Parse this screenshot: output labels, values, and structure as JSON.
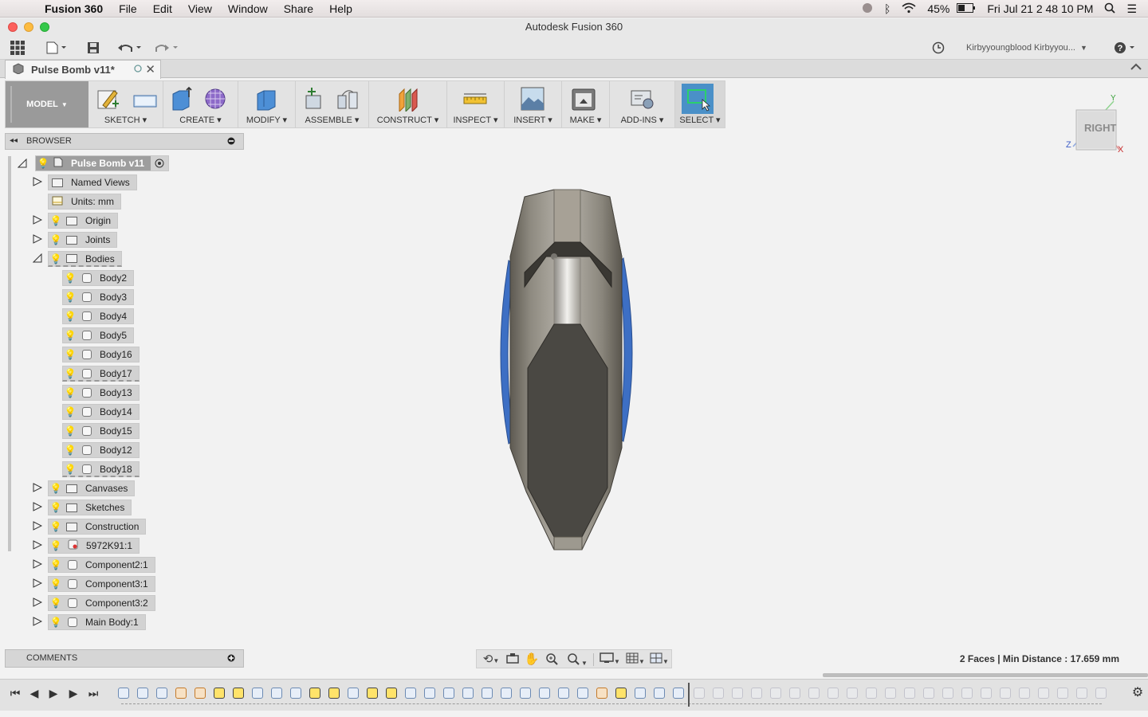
{
  "menubar": {
    "app_name": "Fusion 360",
    "items": [
      "File",
      "Edit",
      "View",
      "Window",
      "Share",
      "Help"
    ],
    "battery": "45%",
    "clock": "Fri Jul 21  2 48 10 PM"
  },
  "window": {
    "title": "Autodesk Fusion 360"
  },
  "quick_access": {
    "user": "Kirbyyoungblood Kirbyyou..."
  },
  "document": {
    "tab_title": "Pulse Bomb v11*"
  },
  "toolbar": {
    "workspace": "MODEL",
    "groups": [
      "SKETCH",
      "CREATE",
      "MODIFY",
      "ASSEMBLE",
      "CONSTRUCT",
      "INSPECT",
      "INSERT",
      "MAKE",
      "ADD-INS",
      "SELECT"
    ]
  },
  "browser": {
    "title": "BROWSER",
    "root": "Pulse Bomb v11",
    "items": {
      "named_views": "Named Views",
      "units": "Units: mm",
      "origin": "Origin",
      "joints": "Joints",
      "bodies": "Bodies",
      "canvases": "Canvases",
      "sketches": "Sketches",
      "construction": "Construction",
      "part_5972": "5972K91:1",
      "component2_1": "Component2:1",
      "component3_1": "Component3:1",
      "component3_2": "Component3:2",
      "main_body": "Main Body:1"
    },
    "bodies": [
      "Body2",
      "Body3",
      "Body4",
      "Body5",
      "Body16",
      "Body17",
      "Body13",
      "Body14",
      "Body15",
      "Body12",
      "Body18"
    ]
  },
  "viewcube": {
    "face": "RIGHT",
    "axis_y": "Y",
    "axis_z": "Z",
    "axis_x": "X"
  },
  "comments": {
    "title": "COMMENTS"
  },
  "status": {
    "text": "2 Faces | Min Distance : 17.659 mm"
  },
  "colors": {
    "accent_blue": "#3d6fc4",
    "select_blue": "#4a90c8",
    "model_gray": "#9a9a9a"
  }
}
